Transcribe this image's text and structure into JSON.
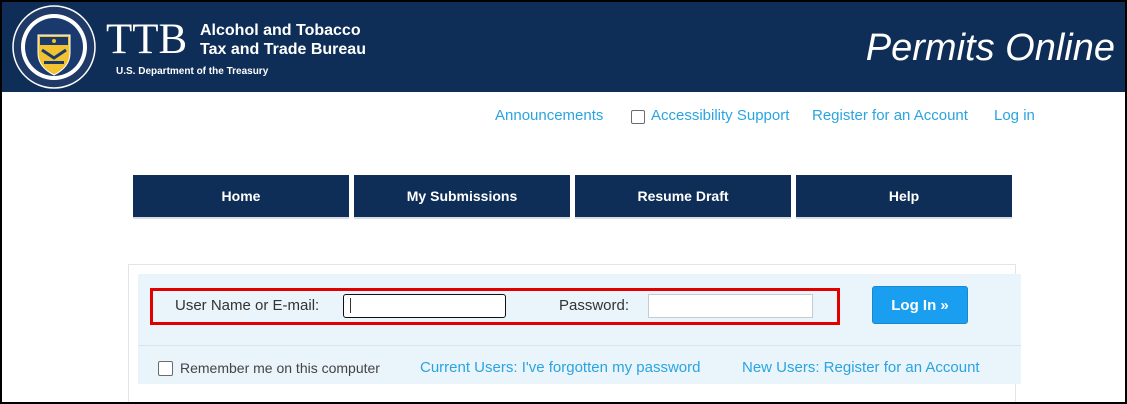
{
  "header": {
    "brand_abbr": "TTB",
    "brand_line1": "Alcohol and Tobacco",
    "brand_line2": "Tax and Trade Bureau",
    "brand_dept": "U.S. Department of the Treasury",
    "seal_text": "ALCOHOL AND TOBACCO TAX AND TRADE BUREAU",
    "app_title": "Permits Online"
  },
  "top_links": {
    "announcements": "Announcements",
    "accessibility": "Accessibility Support",
    "register": "Register for an Account",
    "login": "Log in"
  },
  "nav": {
    "tabs": [
      {
        "label": "Home"
      },
      {
        "label": "My Submissions"
      },
      {
        "label": "Resume Draft"
      },
      {
        "label": "Help"
      }
    ]
  },
  "login_form": {
    "username_label": "User Name or E-mail:",
    "username_value": "",
    "password_label": "Password:",
    "password_value": "",
    "login_button": "Log In »",
    "remember_label": "Remember me on this computer",
    "forgot_link": "Current Users: I've forgotten my password",
    "register_link": "New Users: Register for an Account"
  },
  "colors": {
    "header_bg": "#0f2e57",
    "link": "#2aa4e0",
    "button": "#1a9ff0",
    "highlight": "#e00000",
    "panel_bg": "#eaf4fb"
  }
}
